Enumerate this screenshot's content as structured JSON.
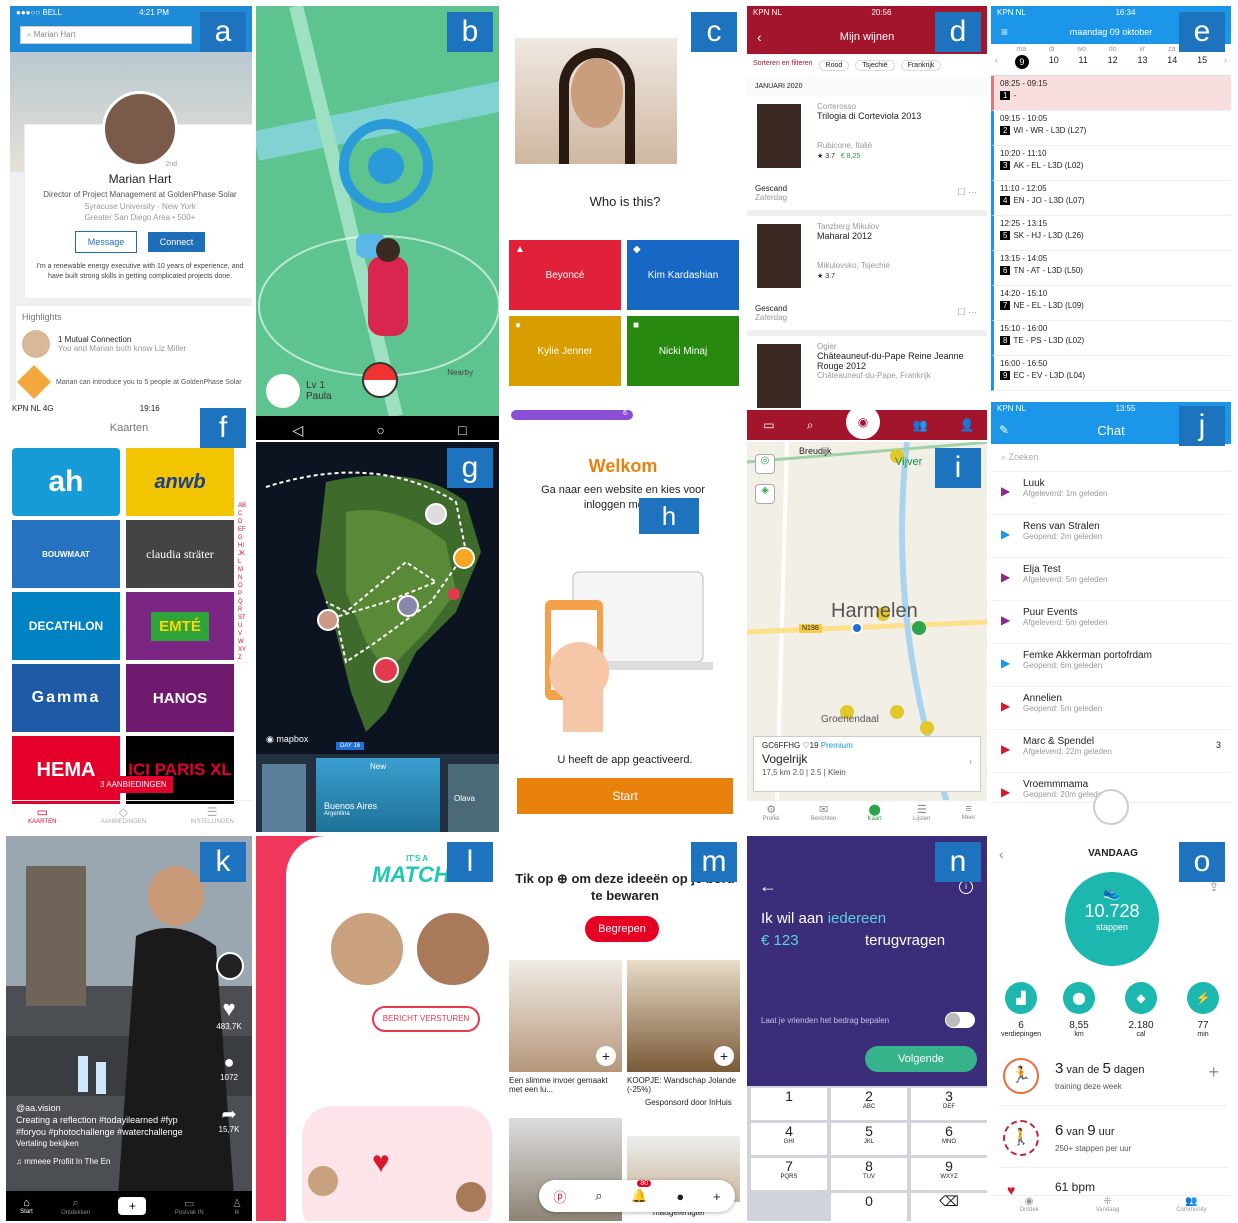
{
  "labels": {
    "a": "a",
    "b": "b",
    "c": "c",
    "d": "d",
    "e": "e",
    "f": "f",
    "g": "g",
    "h": "h",
    "i": "i",
    "j": "j",
    "k": "k",
    "l": "l",
    "m": "m",
    "n": "n",
    "o": "o"
  },
  "a": {
    "carrier": "●●●○○ BELL",
    "time": "4:21 PM",
    "search": "Marian Hart",
    "degree": "2nd",
    "name": "Marian Hart",
    "title": "Director of Project Management at GoldenPhase Solar",
    "school": "Syracuse University - New York",
    "area": "Greater San Diego Area • 500+",
    "message": "Message",
    "connect": "Connect",
    "bio": "I'm a renewable energy executive with 10 years of experience, and have built strong skills in getting complicated projects done.",
    "highlights": "Highlights",
    "mutual": "1 Mutual Connection",
    "mutual_sub": "You and Marian both know Liz Miller",
    "intro": "Marian can introduce you to 5 people at GoldenPhase Solar"
  },
  "b": {
    "level": "Lv 1",
    "player": "Paula",
    "nearby": "Nearby"
  },
  "c": {
    "question": "Who is this?",
    "answers": [
      "Beyoncé",
      "Kim Kardashian",
      "Kylie Jenner",
      "Nicki Minaj"
    ],
    "progress": "6"
  },
  "d": {
    "carrier": "KPN NL",
    "time": "20:56",
    "title": "Mijn wijnen",
    "filters": [
      "Sorteren en filteren",
      "Rood",
      "Tsjechië",
      "Frankrijk"
    ],
    "section": "JANUARI 2020",
    "wines": [
      {
        "producer": "Corterosso",
        "name": "Trilogia di Corteviola 2013",
        "region": "Rubicone, Italië",
        "rating": "3.7",
        "price": "€ 8,25",
        "status": "Gescand",
        "day": "Zaterdag"
      },
      {
        "producer": "Tanzberg Mikulov",
        "name": "Maharal 2012",
        "region": "Mikulovsko, Tsjechië",
        "rating": "3.7",
        "status": "Gescand",
        "day": "Zaterdag"
      },
      {
        "producer": "Ogier",
        "name": "Châteauneuf-du-Pape Reine Jeanne Rouge 2012",
        "region": "Châteauneuf-du-Pape, Frankrijk"
      }
    ]
  },
  "e": {
    "carrier": "KPN NL",
    "time": "16:34",
    "title": "maandag 09 oktober",
    "days": [
      "ma",
      "di",
      "wo",
      "do",
      "vr",
      "za",
      "zo"
    ],
    "dates": [
      "9",
      "10",
      "11",
      "12",
      "13",
      "14",
      "15"
    ],
    "rows": [
      {
        "time": "08:25 - 09:15",
        "num": "1",
        "text": "-"
      },
      {
        "time": "09:15 - 10:05",
        "num": "2",
        "text": "WI - WR - L3D (L27)"
      },
      {
        "time": "10:20 - 11:10",
        "num": "3",
        "text": "AK - EL - L3D (L02)"
      },
      {
        "time": "11:10 - 12:05",
        "num": "4",
        "text": "EN - JO - L3D (L07)"
      },
      {
        "time": "12:25 - 13:15",
        "num": "5",
        "text": "SK - HJ - L3D (L26)"
      },
      {
        "time": "13:15 - 14:05",
        "num": "6",
        "text": "TN - AT - L3D (L50)"
      },
      {
        "time": "14:20 - 15:10",
        "num": "7",
        "text": "NE - EL - L3D (L09)"
      },
      {
        "time": "15:10 - 16:00",
        "num": "8",
        "text": "TE - PS - L3D (L02)"
      },
      {
        "time": "16:00 - 16:50",
        "num": "9",
        "text": "EC - EV - L3D (L04)"
      }
    ]
  },
  "f": {
    "carrier": "KPN NL 4G",
    "time": "19:16",
    "title": "Kaarten",
    "tiles": [
      "ah",
      "anwb",
      "BOUWMAAT",
      "claudia sträter",
      "DECATHLON",
      "EMTÉ",
      "Gamma",
      "HANOS",
      "HEMA",
      "ICI PARIS XL"
    ],
    "offers": "3 AANBIEDINGEN",
    "tabs": [
      "KAARTEN",
      "AANBIEDINGEN",
      "INSTELLINGEN"
    ],
    "alphabet": "ABCDEFGHIJKLMNOPQRSTUVWXYZ"
  },
  "g": {
    "mapbox": "mapbox",
    "day": "DAY 16",
    "new": "New",
    "place": "Buenos Aires",
    "country": "Argentina",
    "next": "Olava"
  },
  "h": {
    "title": "Welkom",
    "text": "Ga naar een website en kies voor inloggen met de",
    "activated": "U heeft de app geactiveerd.",
    "start": "Start"
  },
  "i": {
    "places": [
      "Breudijk",
      "Vijver",
      "Harmelen",
      "Groenendaal",
      "N198"
    ],
    "code": "GC6FFHG",
    "fav": "♡19",
    "premium": "Premium",
    "name": "Vogelrijk",
    "stats": "17,5 km  2.0 | 2.5 | Klein",
    "tabs": [
      "Profiel",
      "Berichten",
      "Kaart",
      "Lijsten",
      "Meer"
    ]
  },
  "j": {
    "carrier": "KPN NL",
    "time": "13:55",
    "title": "Chat",
    "search": "Zoeken",
    "chats": [
      {
        "name": "Luuk",
        "sub": "Afgeleverd: 1m geleden"
      },
      {
        "name": "Rens van Stralen",
        "sub": "Geopend: 2m geleden"
      },
      {
        "name": "Elja Test",
        "sub": "Afgeleverd: 5m geleden"
      },
      {
        "name": "Puur Events",
        "sub": "Afgeleverd: 5m geleden"
      },
      {
        "name": "Femke Akkerman portofrdam",
        "sub": "Geopend: 6m geleden"
      },
      {
        "name": "Annelien",
        "sub": "Geopend: 5m geleden"
      },
      {
        "name": "Marc & Spendel",
        "sub": "Afgeleverd: 22m geleden"
      },
      {
        "name": "Vroemmmama",
        "sub": "Geopend: 20m geleden"
      }
    ],
    "score": "3"
  },
  "k": {
    "likes": "483,7K",
    "comments": "1072",
    "shares": "15,7K",
    "user": "@aa.vision",
    "caption": "Creating a reflection #todayilearned #fyp #foryou #photochallenge #waterchallenge",
    "translate": "Vertaling bekijken",
    "music": "mmeee Profiit   In The En",
    "tabs": [
      "Start",
      "Ontdekken",
      "+",
      "Postvak IN",
      "Ik"
    ]
  },
  "l": {
    "itsa": "IT'S A",
    "match": "MATCH!",
    "send": "BERICHT VERSTUREN"
  },
  "m": {
    "header": "Tik op ⊕ om deze ideeën op je bord te bewaren",
    "understood": "Begrepen",
    "pins": [
      {
        "title": "Een slimme invoer gemaakt met een lu...",
        "sub": ""
      },
      {
        "title": "KOOPJE: Wandschap Jolande (-25%)",
        "sub": "Gesponsord door InHuis"
      },
      {
        "title": "",
        "sub": ""
      },
      {
        "title": "maßgefertigter",
        "sub": ""
      }
    ],
    "badge": "80"
  },
  "n": {
    "line1_pre": "Ik wil aan ",
    "line1_hl": "iedereen",
    "amount": "€ 123",
    "line2": "terugvragen",
    "toggle": "Laat je vrienden het bedrag bepalen",
    "next": "Volgende",
    "keys": [
      [
        "1",
        ""
      ],
      [
        "2",
        "ABC"
      ],
      [
        "3",
        "DEF"
      ],
      [
        "4",
        "GHI"
      ],
      [
        "5",
        "JKL"
      ],
      [
        "6",
        "MNO"
      ],
      [
        "7",
        "PQRS"
      ],
      [
        "8",
        "TUV"
      ],
      [
        "9",
        "WXYZ"
      ],
      [
        "",
        ""
      ],
      [
        "0",
        ""
      ],
      [
        "⌫",
        ""
      ]
    ]
  },
  "o": {
    "title": "VANDAAG",
    "steps": "10.728",
    "steps_label": "stappen",
    "stats": [
      {
        "v": "6",
        "l": "verdiepingen"
      },
      {
        "v": "8,55",
        "l": "km"
      },
      {
        "v": "2.180",
        "l": "cal"
      },
      {
        "v": "77",
        "l": "min"
      }
    ],
    "goal1_pre": "3",
    "goal1_mid": " van de ",
    "goal1_big": "5",
    "goal1_post": " dagen",
    "goal1_sub": "training deze week",
    "goal2_pre": "6",
    "goal2_mid": " van ",
    "goal2_big": "9",
    "goal2_post": " uur",
    "goal2_sub": "250+ stappen per uur",
    "bpm": "61 bpm",
    "tabs": [
      "Ontdek",
      "Vandaag",
      "Community"
    ],
    "accent": "#1cb8b0"
  }
}
